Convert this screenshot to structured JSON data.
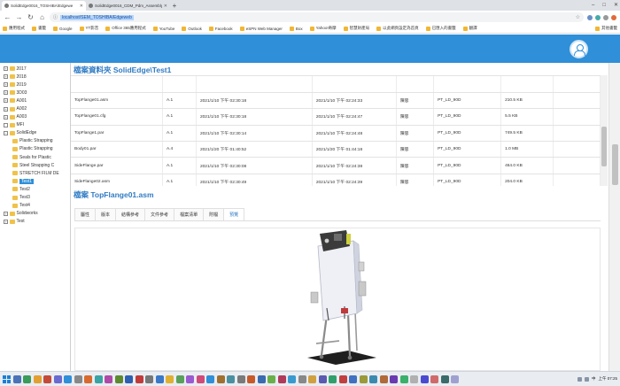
{
  "browser": {
    "tabs": [
      {
        "title": "SolidEdge0016_TOSHIBA\\Edgewe",
        "active": true
      },
      {
        "title": "SolidEdge0016_CDM_Pdm_Assembly",
        "active": false
      }
    ],
    "new_tab": "+",
    "window_controls": [
      "–",
      "□",
      "✕"
    ],
    "nav": {
      "back": "←",
      "forward": "→",
      "reload": "↻",
      "home": "⌂"
    },
    "url": "localhost/SEM_TOSHIBA/Edgeweb"
  },
  "bookmarks": [
    {
      "label": "應用程式"
    },
    {
      "label": "書籤"
    },
    {
      "label": "Google"
    },
    {
      "label": "YT影音"
    },
    {
      "label": "Office 365應用程式"
    },
    {
      "label": "YouTube"
    },
    {
      "label": "Outlook"
    },
    {
      "label": "Facebook"
    },
    {
      "label": "eSPN Web Manager"
    },
    {
      "label": "Box"
    },
    {
      "label": "Yahoo!奇摩"
    },
    {
      "label": "智慧財產局"
    },
    {
      "label": "以此網頁設定為首頁"
    },
    {
      "label": "已匯入的書籤"
    },
    {
      "label": "翻譯"
    }
  ],
  "bookmarks_right": "其他書籤",
  "tree": {
    "nodes": [
      {
        "label": "2017",
        "exp": "+",
        "indent": 1
      },
      {
        "label": "2018",
        "exp": "+",
        "indent": 1
      },
      {
        "label": "2019",
        "exp": "+",
        "indent": 1
      },
      {
        "label": "3D03",
        "exp": "+",
        "indent": 1
      },
      {
        "label": "A001",
        "exp": "+",
        "indent": 1
      },
      {
        "label": "A002",
        "exp": "+",
        "indent": 1
      },
      {
        "label": "A003",
        "exp": "+",
        "indent": 1
      },
      {
        "label": "MFI",
        "exp": "",
        "indent": 1
      },
      {
        "label": "SolidEdge",
        "exp": "−",
        "indent": 1
      },
      {
        "label": "Plastic Strapping",
        "exp": "",
        "indent": 2
      },
      {
        "label": "Plastic Strapping",
        "exp": "",
        "indent": 2
      },
      {
        "label": "Seals for Plastic",
        "exp": "",
        "indent": 2
      },
      {
        "label": "Steel Strapping C",
        "exp": "",
        "indent": 2
      },
      {
        "label": "STRETCH FILM DE",
        "exp": "",
        "indent": 2
      },
      {
        "label": "Test1",
        "exp": "",
        "indent": 2,
        "selected": true
      },
      {
        "label": "Test2",
        "exp": "",
        "indent": 2
      },
      {
        "label": "Test3",
        "exp": "",
        "indent": 2
      },
      {
        "label": "Test4",
        "exp": "",
        "indent": 2
      },
      {
        "label": "Solidworks",
        "exp": "+",
        "indent": 1
      },
      {
        "label": "Test",
        "exp": "+",
        "indent": 1
      }
    ]
  },
  "main": {
    "folder_title": "檔案資料夾 SolidEdge\\Test1",
    "files": [
      [
        "",
        "",
        "",
        "",
        "",
        "",
        "",
        ""
      ],
      [
        "TopFlange01.asm",
        "A.1",
        "2021/1/10 下午 02:30:18",
        "2021/1/10 下午 02:24:33",
        "陳思",
        "PT_LD_90D",
        "210.5 KB",
        ""
      ],
      [
        "TopFlange01.cfg",
        "A.1",
        "2021/1/10 下午 02:30:18",
        "2021/1/10 下午 02:24:47",
        "陳思",
        "PT_LD_90D",
        "5.5 KB",
        ""
      ],
      [
        "TopFlange1.par",
        "A.1",
        "2021/1/10 下午 02:30:14",
        "2021/1/10 下午 02:24:48",
        "陳思",
        "PT_LD_90D",
        "749.5 KB",
        ""
      ],
      [
        "Body01.par",
        "A.4",
        "2021/1/20 下午 01:40:52",
        "2021/1/20 下午 01:44:18",
        "陳思",
        "PT_LD_90D",
        "1.0 MB",
        ""
      ],
      [
        "SideFlange.par",
        "A.1",
        "2021/1/10 下午 02:30:08",
        "2021/1/10 下午 02:24:38",
        "陳思",
        "PT_LD_90D",
        "464.0 KB",
        ""
      ],
      [
        "SideFlange02.asm",
        "A.1",
        "2021/1/10 下午 02:30:49",
        "2021/1/10 下午 02:24:39",
        "陳思",
        "PT_LD_90D",
        "204.0 KB",
        ""
      ]
    ],
    "detail_title": "檔案 TopFlange01.asm",
    "tabs": [
      {
        "label": "屬性",
        "active": false
      },
      {
        "label": "版本",
        "active": false
      },
      {
        "label": "結構參考",
        "active": false
      },
      {
        "label": "文件參考",
        "active": false
      },
      {
        "label": "檔案清單",
        "active": false
      },
      {
        "label": "附檔",
        "active": false
      },
      {
        "label": "預覽",
        "active": true
      }
    ]
  },
  "taskbar": {
    "clock": "上午 07:25",
    "lang": "中"
  },
  "colors": {
    "accent": "#2f8fd8",
    "title": "#2f7bc4",
    "folder": "#f0c24a"
  }
}
